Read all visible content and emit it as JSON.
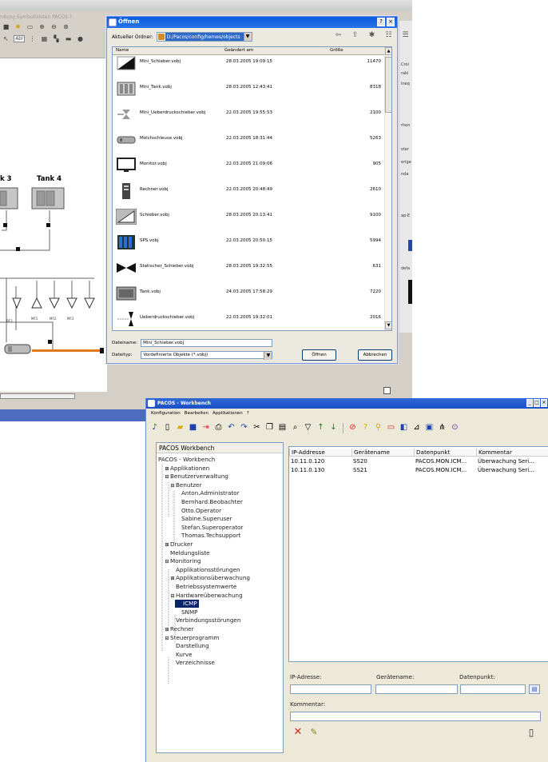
{
  "editor": {
    "menu_text": "ndung  Symbolleisten  PACOS  ?",
    "tank_labels": [
      "k 3",
      "Tank 4"
    ],
    "valve_labels": [
      "BF3",
      "MF1",
      "MF2",
      "MF3"
    ],
    "right_strip_labels": [
      "Croi",
      "raki",
      "ineq",
      "rhen",
      "ster",
      "erige",
      "nda",
      "ap-E",
      "defa"
    ]
  },
  "dialog": {
    "title": "Öffnen",
    "help_button": "?",
    "close_button": "×",
    "look_in_label": "Aktueller Ordner:",
    "look_in_value": "D:/Pacos/config/hemes/objects",
    "columns": {
      "name": "Name",
      "date": "Geändert am",
      "size": "Größe"
    },
    "files": [
      {
        "name": "Mini_Schieber.vobj",
        "date": "28.03.2005 19:09:15",
        "size": "11470"
      },
      {
        "name": "Mini_Tank.vobj",
        "date": "28.03.2005 12:43:41",
        "size": "8318"
      },
      {
        "name": "Mini_Ueberdruckschieber.vobj",
        "date": "22.03.2005 19:55:53",
        "size": "2100"
      },
      {
        "name": "Molchschleuse.vobj",
        "date": "22.03.2005 18:31:44",
        "size": "5263"
      },
      {
        "name": "Monitor.vobj",
        "date": "22.03.2005 21:09:06",
        "size": "905"
      },
      {
        "name": "Rechner.vobj",
        "date": "22.03.2005 20:48:49",
        "size": "2610"
      },
      {
        "name": "Schieber.vobj",
        "date": "28.03.2005 20:13:41",
        "size": "9100"
      },
      {
        "name": "SPS.vobj",
        "date": "22.03.2005 20:50:15",
        "size": "5994"
      },
      {
        "name": "Statischer_Schieber.vobj",
        "date": "28.03.2005 19:32:55",
        "size": "631"
      },
      {
        "name": "Tank.vobj",
        "date": "24.03.2005 17:58:29",
        "size": "7220"
      },
      {
        "name": "Ueberdruckschieber.vobj",
        "date": "22.03.2005 19:32:01",
        "size": "2016"
      }
    ],
    "filename_label": "Dateiname:",
    "filename_value": "Mini_Schieber.vobj",
    "filetype_label": "Dateityp:",
    "filetype_value": "Vordefinierte Objekte (*.vobj)",
    "open_button": "Öffnen",
    "cancel_button": "Abbrechen"
  },
  "workbench": {
    "title": "PACOS - Workbench",
    "title_buttons": [
      "_",
      "□",
      "×"
    ],
    "menu": [
      "Konfiguration",
      "Bearbeiten",
      "Applikationen",
      "?"
    ],
    "tree_header": "PACOS Workbench",
    "tree": [
      {
        "label": "PACOS - Workbench",
        "depth": 0,
        "glyph": ""
      },
      {
        "label": "Applikationen",
        "depth": 1,
        "glyph": "⊞"
      },
      {
        "label": "Benutzerverwaltung",
        "depth": 1,
        "glyph": "⊟"
      },
      {
        "label": "Benutzer",
        "depth": 2,
        "glyph": "⊟"
      },
      {
        "label": "Anton.Administrator",
        "depth": 3,
        "glyph": ""
      },
      {
        "label": "Bernhard.Beobachter",
        "depth": 3,
        "glyph": ""
      },
      {
        "label": "Otto.Operator",
        "depth": 3,
        "glyph": ""
      },
      {
        "label": "Sabine.Superuser",
        "depth": 3,
        "glyph": ""
      },
      {
        "label": "Stefan.Superoperator",
        "depth": 3,
        "glyph": ""
      },
      {
        "label": "Thomas.Techsupport",
        "depth": 3,
        "glyph": ""
      },
      {
        "label": "Drucker",
        "depth": 1,
        "glyph": "⊞"
      },
      {
        "label": "Meldungsliste",
        "depth": 1,
        "glyph": ""
      },
      {
        "label": "Monitoring",
        "depth": 1,
        "glyph": "⊟"
      },
      {
        "label": "Applikationsstörungen",
        "depth": 2,
        "glyph": ""
      },
      {
        "label": "Applikationsüberwachung",
        "depth": 2,
        "glyph": "⊞"
      },
      {
        "label": "Betriebssystemwerte",
        "depth": 2,
        "glyph": ""
      },
      {
        "label": "Hardwareüberwachung",
        "depth": 2,
        "glyph": "⊟"
      },
      {
        "label": "ICMP",
        "depth": 3,
        "glyph": "",
        "selected": true
      },
      {
        "label": "SNMP",
        "depth": 3,
        "glyph": ""
      },
      {
        "label": "Verbindungsstörungen",
        "depth": 2,
        "glyph": ""
      },
      {
        "label": "Rechner",
        "depth": 1,
        "glyph": "⊞"
      },
      {
        "label": "Steuerprogramm",
        "depth": 1,
        "glyph": "⊟"
      },
      {
        "label": "Darstellung",
        "depth": 2,
        "glyph": ""
      },
      {
        "label": "Kurve",
        "depth": 2,
        "glyph": ""
      },
      {
        "label": "Verzeichnisse",
        "depth": 2,
        "glyph": ""
      }
    ],
    "grid": {
      "columns": [
        "IP-Addresse",
        "Gerätename",
        "Datenpunkt",
        "Kommentar"
      ],
      "rows": [
        [
          "10.11.0.120",
          "SS20",
          "PACOS.MON.ICM...",
          "Überwachung Seri..."
        ],
        [
          "10.11.0.130",
          "SS21",
          "PACOS.MON.ICM...",
          "Überwachung Seri..."
        ]
      ]
    },
    "form": {
      "ip_label": "IP-Adresse:",
      "device_label": "Gerätename:",
      "datapoint_label": "Datenpunkt:",
      "comment_label": "Kommentar:"
    },
    "colors": {
      "selection": "#0a246a",
      "title": "#3168d5",
      "pipe": "#e07a1a",
      "highlight": "#f3e23a"
    }
  }
}
